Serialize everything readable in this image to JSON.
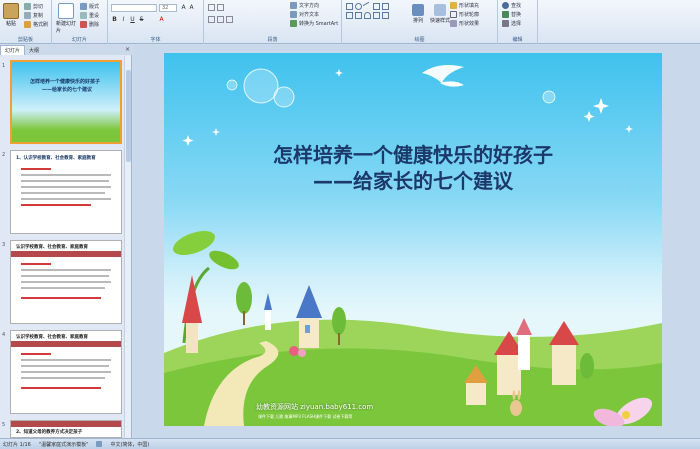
{
  "ribbon": {
    "clipboard": {
      "paste": "粘贴",
      "cut": "剪切",
      "copy": "复制",
      "format_painter": "格式刷",
      "label": "剪贴板"
    },
    "slides": {
      "new_slide": "新建幻灯片",
      "layout": "版式",
      "reset": "重设",
      "delete": "删除",
      "label": "幻灯片"
    },
    "font": {
      "font_size": "32",
      "label": "字体"
    },
    "paragraph": {
      "text_direction": "文字方向",
      "align_text": "对齐文本",
      "smartart": "转换为 SmartArt",
      "label": "段落"
    },
    "drawing": {
      "arrange": "排列",
      "quick_styles": "快速样式",
      "shape_fill": "形状填充",
      "shape_outline": "形状轮廓",
      "shape_effects": "形状效果",
      "label": "绘图"
    },
    "editing": {
      "find": "查找",
      "replace": "替换",
      "select": "选择",
      "label": "编辑"
    }
  },
  "pane": {
    "tabs": [
      "幻灯片",
      "大纲"
    ],
    "close": "×",
    "thumbs": [
      {
        "num": "1",
        "title": "怎样培养一个健康快乐的好孩子",
        "subtitle": "——给家长的七个建议"
      },
      {
        "num": "2",
        "title": "1、认识学校教育、社会教育、家庭教育"
      },
      {
        "num": "3",
        "title": "认识学校教育、社会教育、家庭教育"
      },
      {
        "num": "4",
        "title": "认识学校教育、社会教育、家庭教育"
      },
      {
        "num": "5",
        "title": "2、知道父母的教养方式决定孩子"
      }
    ]
  },
  "slide": {
    "title_line1": "怎样培养一个健康快乐的好孩子",
    "title_line2": "——给家长的七个建议",
    "site": "幼教资源网站  ziyuan.baby611.com",
    "links": "课件下载  儿歌  故事MP3  FLASH课件下载  试卷下载等"
  },
  "status": {
    "slide_info": "幻灯片 1/16",
    "theme": "\"温馨家庭式演示模板\"",
    "language": "中文(简体，中国)"
  },
  "colors": {
    "title": "#1b3868",
    "sky_top": "#3fc2ee",
    "grass": "#7cc63c",
    "selected_thumb_border": "#f0a030"
  }
}
